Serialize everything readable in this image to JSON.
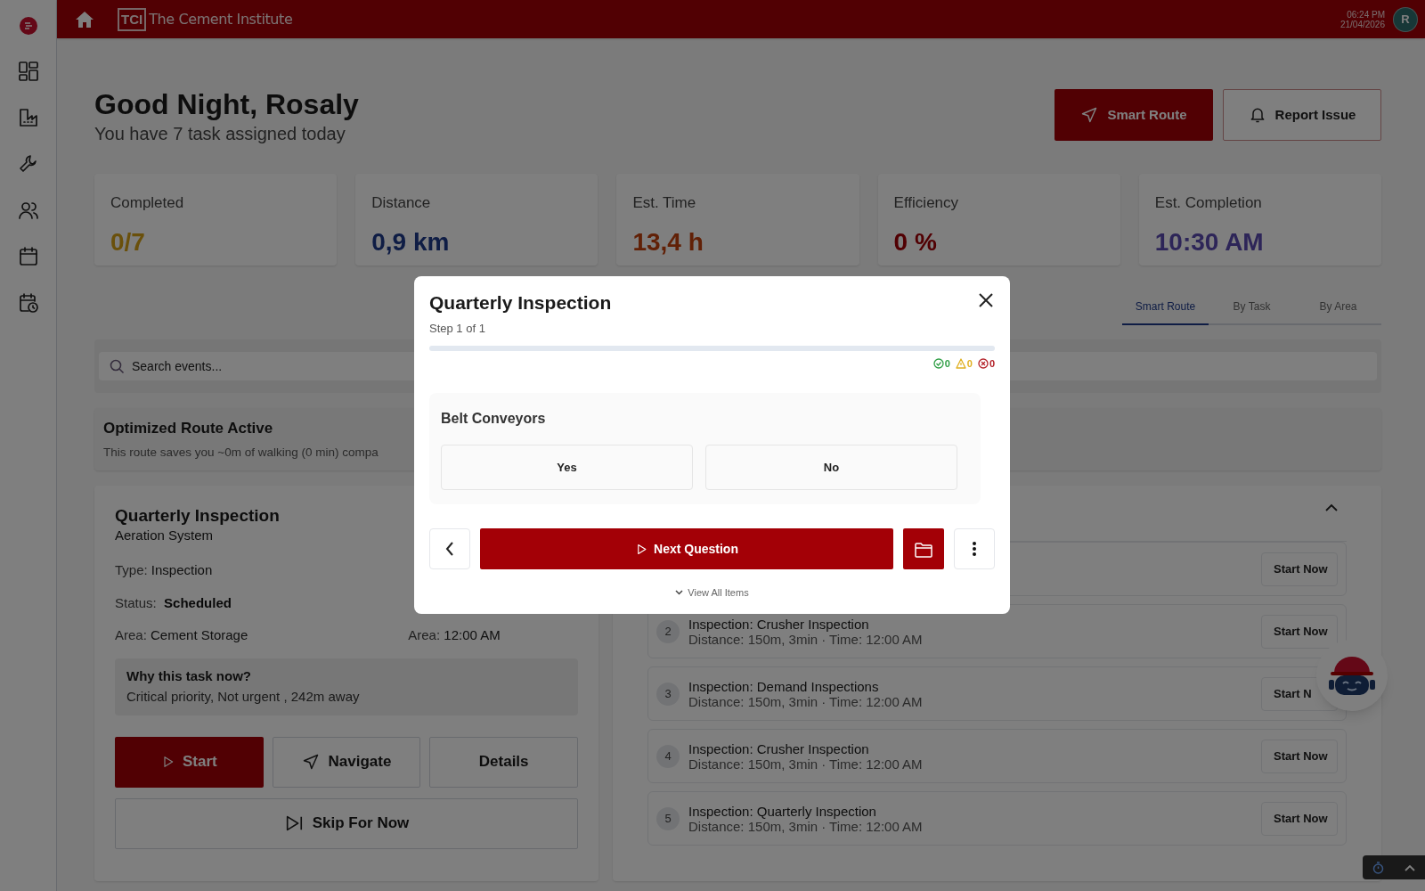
{
  "topbar": {
    "logo_mark": "TCI",
    "brand": "The Cement Institute",
    "time": "06:24 PM",
    "date": "21/04/2026",
    "avatar": "R"
  },
  "header": {
    "greeting": "Good Night, Rosaly",
    "subtitle": "You have 7 task assigned today",
    "actions": [
      {
        "label": "Smart Route",
        "kind": "primary"
      },
      {
        "label": "Report Issue",
        "kind": "outline"
      }
    ]
  },
  "stats": [
    {
      "kind": "progress",
      "label": "Completed",
      "value": "0/7"
    },
    {
      "kind": "distance",
      "label": "Distance",
      "value": "0,9 km"
    },
    {
      "kind": "time",
      "label": "Est. Time",
      "value": "13,4 h"
    },
    {
      "kind": "efficiency",
      "label": "Efficiency",
      "value": "0 %"
    },
    {
      "kind": "eta",
      "label": "Est. Completion",
      "value": "10:30 AM"
    }
  ],
  "view_tabs": [
    {
      "label": "Smart Route",
      "selected": true
    },
    {
      "label": "By Task",
      "selected": false
    },
    {
      "label": "By Area",
      "selected": false
    }
  ],
  "search": {
    "placeholder": "Search events..."
  },
  "route_banner": {
    "title": "Optimized Route Active",
    "text": "This route saves you ~0m of walking (0 min) compa"
  },
  "current_task": {
    "title": "Quarterly Inspection",
    "subtitle": "Aeration System",
    "fields": [
      {
        "kind": "plain",
        "label": "Type:",
        "value": "Inspection"
      },
      {
        "kind": "status",
        "label": "Status:",
        "value": "Scheduled"
      },
      {
        "kind": "plain",
        "label": "Area:",
        "value": "Cement Storage"
      }
    ],
    "time_field": {
      "label": "Area:",
      "value": "12:00 AM"
    },
    "reason": {
      "title": "Why this task now?",
      "text": "Critical priority, Not urgent , 242m away"
    },
    "actions": [
      {
        "label": "Start",
        "kind": "primary"
      },
      {
        "label": "Navigate",
        "kind": "navigate"
      },
      {
        "label": "Details",
        "kind": "plain"
      }
    ],
    "skip": "Skip For Now"
  },
  "route_list": {
    "expanded": true,
    "tasks": [
      {
        "button": "Start Now"
      },
      {
        "number": "2",
        "title": "Inspection: Crusher Inspection",
        "detail": "Distance: 150m, 3min · Time: 12:00 AM",
        "button": "Start Now"
      },
      {
        "number": "3",
        "title": "Inspection: Demand Inspections",
        "detail": "Distance: 150m, 3min · Time: 12:00 AM",
        "button": "Start N"
      },
      {
        "number": "4",
        "title": "Inspection: Crusher Inspection",
        "detail": "Distance: 150m, 3min · Time: 12:00 AM",
        "button": "Start Now"
      },
      {
        "number": "5",
        "title": "Inspection: Quarterly Inspection",
        "detail": "Distance: 150m, 3min · Time: 12:00 AM",
        "button": "Start Now"
      }
    ]
  },
  "modal": {
    "title": "Quarterly Inspection",
    "step": "Step 1 of 1",
    "counters": [
      {
        "kind": "passed",
        "value": "0"
      },
      {
        "kind": "warning",
        "value": "0"
      },
      {
        "kind": "failed",
        "value": "0"
      }
    ],
    "question": {
      "title": "Belt Conveyors",
      "options": [
        {
          "label": "Yes",
          "selected": false
        },
        {
          "label": "No",
          "selected": false
        }
      ]
    },
    "next_label": "Next Question",
    "view_all": "View All Items"
  }
}
